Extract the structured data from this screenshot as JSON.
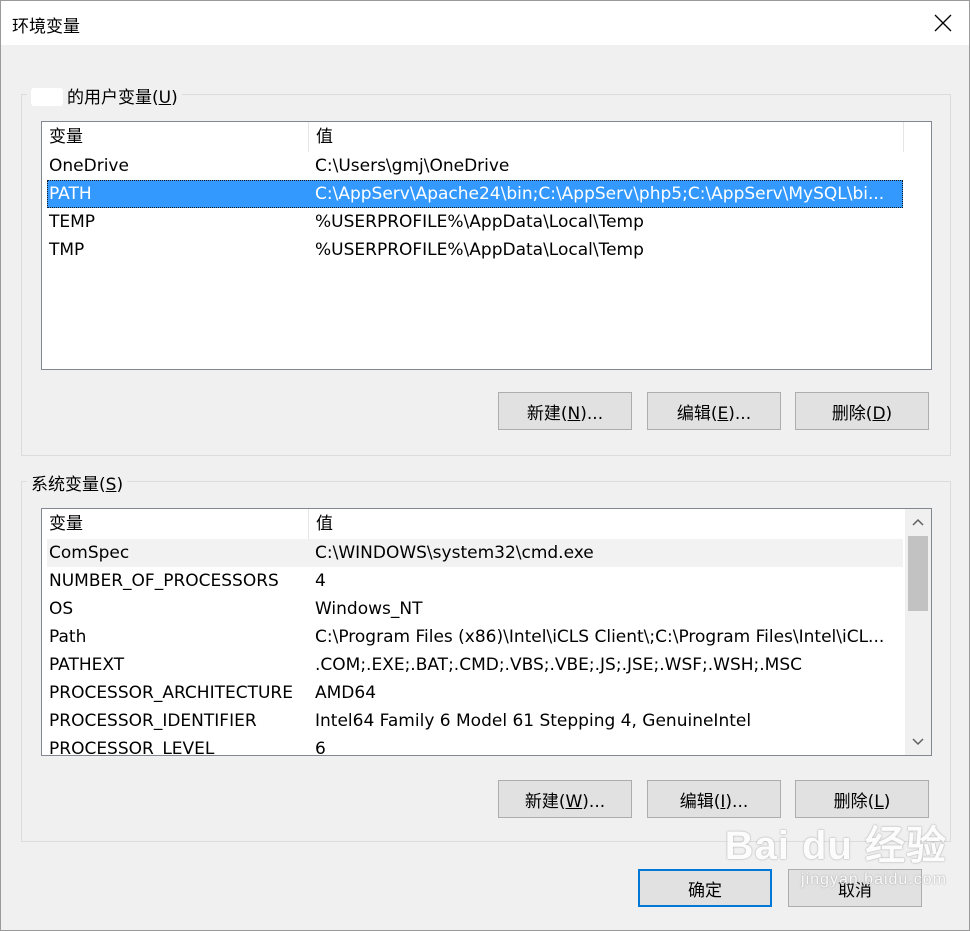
{
  "window": {
    "title": "环境变量",
    "close_icon": "close-icon"
  },
  "user_vars": {
    "legend_text": "的用户变量(",
    "legend_mnemonic": "U",
    "legend_suffix": ")",
    "columns": [
      "变量",
      "值"
    ],
    "rows": [
      {
        "name": "OneDrive",
        "value": "C:\\Users\\gmj\\OneDrive"
      },
      {
        "name": "PATH",
        "value": "C:\\AppServ\\Apache24\\bin;C:\\AppServ\\php5;C:\\AppServ\\MySQL\\bi...",
        "selected": true
      },
      {
        "name": "TEMP",
        "value": "%USERPROFILE%\\AppData\\Local\\Temp"
      },
      {
        "name": "TMP",
        "value": "%USERPROFILE%\\AppData\\Local\\Temp"
      }
    ],
    "buttons": {
      "new": {
        "pre": "新建(",
        "key": "N",
        "post": ")..."
      },
      "edit": {
        "pre": "编辑(",
        "key": "E",
        "post": ")..."
      },
      "delete": {
        "pre": "删除(",
        "key": "D",
        "post": ")"
      }
    }
  },
  "system_vars": {
    "legend_text": "系统变量(",
    "legend_mnemonic": "S",
    "legend_suffix": ")",
    "columns": [
      "变量",
      "值"
    ],
    "rows": [
      {
        "name": "ComSpec",
        "value": "C:\\WINDOWS\\system32\\cmd.exe",
        "hover": true
      },
      {
        "name": "NUMBER_OF_PROCESSORS",
        "value": "4"
      },
      {
        "name": "OS",
        "value": "Windows_NT"
      },
      {
        "name": "Path",
        "value": "C:\\Program Files (x86)\\Intel\\iCLS Client\\;C:\\Program Files\\Intel\\iCL..."
      },
      {
        "name": "PATHEXT",
        "value": ".COM;.EXE;.BAT;.CMD;.VBS;.VBE;.JS;.JSE;.WSF;.WSH;.MSC"
      },
      {
        "name": "PROCESSOR_ARCHITECTURE",
        "value": "AMD64"
      },
      {
        "name": "PROCESSOR_IDENTIFIER",
        "value": "Intel64 Family 6 Model 61 Stepping 4, GenuineIntel"
      },
      {
        "name": "PROCESSOR_LEVEL",
        "value": "6"
      }
    ],
    "buttons": {
      "new": {
        "pre": "新建(",
        "key": "W",
        "post": ")..."
      },
      "edit": {
        "pre": "编辑(",
        "key": "I",
        "post": ")..."
      },
      "delete": {
        "pre": "删除(",
        "key": "L",
        "post": ")"
      }
    },
    "scroll_position": 0
  },
  "footer": {
    "ok_label": "确定",
    "cancel_label": "取消"
  },
  "watermark": {
    "brand": "Bai du 经验",
    "sub": "jingyan.baidu.com"
  }
}
